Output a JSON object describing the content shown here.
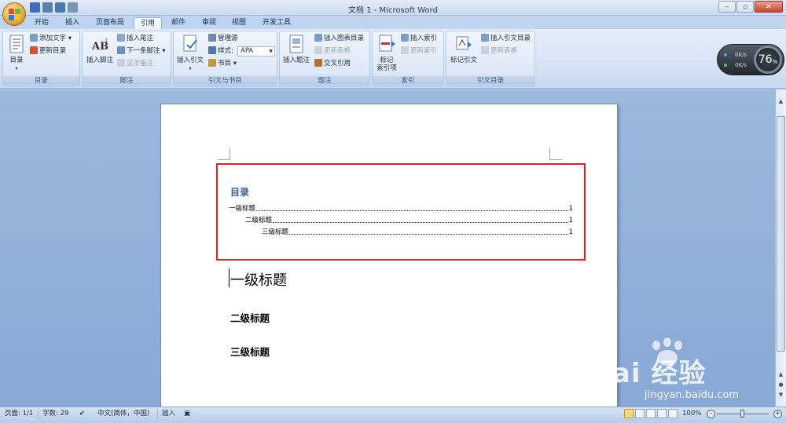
{
  "window": {
    "title": "文档 1 - Microsoft Word"
  },
  "tabs": [
    "开始",
    "插入",
    "页面布局",
    "引用",
    "邮件",
    "审阅",
    "视图",
    "开发工具"
  ],
  "active_tab": "引用",
  "ribbon": {
    "toc": {
      "label": "目录",
      "big": "目录",
      "add_text": "添加文字",
      "update": "更新目录"
    },
    "footnote": {
      "label": "脚注",
      "insert": "插入脚注",
      "endnote": "插入尾注",
      "next": "下一条脚注",
      "show": "显示备注"
    },
    "citation": {
      "label": "引文与书目",
      "insert": "插入引文",
      "manage": "管理源",
      "style_label": "样式:",
      "style_value": "APA",
      "bib": "书目"
    },
    "caption": {
      "label": "题注",
      "insert": "插入题注",
      "tof": "插入图表目录",
      "update": "更新表格",
      "cross": "交叉引用"
    },
    "index": {
      "label": "索引",
      "mark": "标记",
      "mark2": "索引项",
      "insert": "插入索引",
      "update": "更新索引"
    },
    "toa": {
      "label": "引文目录",
      "mark": "标记引文",
      "insert": "插入引文目录",
      "update": "更新表格"
    }
  },
  "gauge": {
    "up": "0K/s",
    "down": "0K/s",
    "percent": "76",
    "unit": "%"
  },
  "document": {
    "toc_title": "目录",
    "toc_entries": [
      {
        "text": "一级标题",
        "page": "1"
      },
      {
        "text": "二级标题",
        "page": "1"
      },
      {
        "text": "三级标题",
        "page": "1"
      }
    ],
    "heading1": "一级标题",
    "heading2": "二级标题",
    "heading3": "三级标题"
  },
  "watermark": {
    "text": "Bai 经验",
    "url": "jingyan.baidu.com"
  },
  "status": {
    "page": "页面: 1/1",
    "words": "字数: 29",
    "lang": "中文(简体，中国)",
    "mode": "插入",
    "zoom": "100%"
  },
  "colors": {
    "accent_red": "#e02020",
    "heading_blue": "#365f91"
  }
}
